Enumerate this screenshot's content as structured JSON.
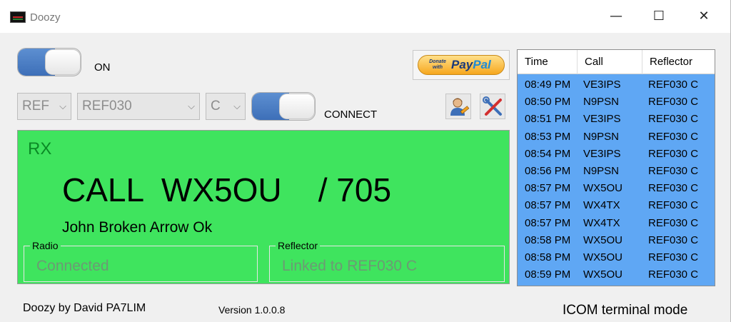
{
  "window": {
    "title": "Doozy",
    "min": "—",
    "max": "☐",
    "close": "✕"
  },
  "power": {
    "label": "ON"
  },
  "paypal": {
    "small": "Donate with",
    "brand_a": "Pay",
    "brand_b": "Pal"
  },
  "connection": {
    "ref_select": "REF",
    "reflector_select": "REF030",
    "module_select": "C",
    "label": "CONNECT",
    "chevron": "⌵"
  },
  "rx": {
    "label": "RX",
    "call_line": "CALL  WX5OU    / 705",
    "name": "John Broken Arrow Ok",
    "radio_title": "Radio",
    "radio_value": "Connected",
    "reflector_title": "Reflector",
    "reflector_value": "Linked to REF030 C"
  },
  "log": {
    "headers": [
      "Time",
      "Call",
      "Reflector"
    ],
    "rows": [
      [
        "08:49 PM",
        "VE3IPS",
        "REF030 C"
      ],
      [
        "08:50 PM",
        "N9PSN",
        "REF030 C"
      ],
      [
        "08:51 PM",
        "VE3IPS",
        "REF030 C"
      ],
      [
        "08:53 PM",
        "N9PSN",
        "REF030 C"
      ],
      [
        "08:54 PM",
        "VE3IPS",
        "REF030 C"
      ],
      [
        "08:56 PM",
        "N9PSN",
        "REF030 C"
      ],
      [
        "08:57 PM",
        "WX5OU",
        "REF030 C"
      ],
      [
        "08:57 PM",
        "WX4TX",
        "REF030 C"
      ],
      [
        "08:57 PM",
        "WX4TX",
        "REF030 C"
      ],
      [
        "08:58 PM",
        "WX5OU",
        "REF030 C"
      ],
      [
        "08:58 PM",
        "WX5OU",
        "REF030 C"
      ],
      [
        "08:59 PM",
        "WX5OU",
        "REF030 C"
      ]
    ]
  },
  "footer": {
    "author": "Doozy by David PA7LIM",
    "version": "Version 1.0.0.8",
    "mode": "ICOM terminal mode"
  },
  "colors": {
    "rx_background": "#3fe45e",
    "log_background": "#5fa7f4",
    "toggle_accent": "#4a7cc4"
  }
}
